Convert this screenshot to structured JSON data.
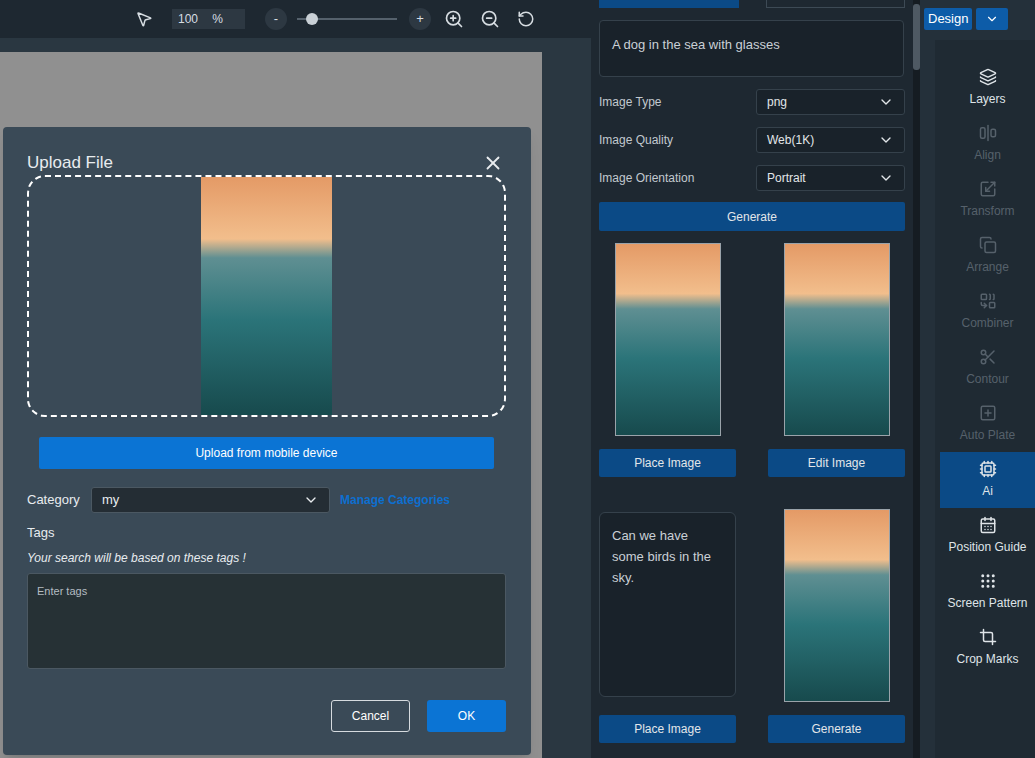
{
  "toolbar": {
    "zoom": "100",
    "unit": "%",
    "zoom_out_button": "-",
    "zoom_in_button": "+",
    "zoom_slider": {
      "level": 0.15
    }
  },
  "upload_dialog": {
    "title": "Upload File",
    "upload_button": "Upload from mobile device",
    "category": {
      "label": "Category",
      "value": "my",
      "link": "Manage Categories"
    },
    "tags": {
      "label": "Tags",
      "hint": "Your search will be based on these tags !",
      "placeholder": "Enter tags"
    },
    "buttons": [
      {
        "label": "Cancel",
        "primary": false
      },
      {
        "label": "OK",
        "primary": true
      }
    ]
  },
  "ai_panel": {
    "prompt": "A dog in the sea with glasses",
    "settings": [
      {
        "label": "Image Type",
        "value": "png"
      },
      {
        "label": "Image Quality",
        "value": "Web(1K)"
      },
      {
        "label": "Image Orientation",
        "value": "Portrait"
      }
    ],
    "generate_button": "Generate",
    "results": [
      {
        "kind": "image",
        "button": "Place Image"
      },
      {
        "kind": "image",
        "button": "Edit Image"
      },
      {
        "kind": "prompt",
        "text": "Can we have some birds in the sky.",
        "button": "Place Image"
      },
      {
        "kind": "image",
        "button": "Generate"
      }
    ]
  },
  "sidebar": {
    "design_button": "Design",
    "items": [
      {
        "label": "Layers",
        "selected": false,
        "disabled": false
      },
      {
        "label": "Align",
        "selected": false,
        "disabled": true
      },
      {
        "label": "Transform",
        "selected": false,
        "disabled": true
      },
      {
        "label": "Arrange",
        "selected": false,
        "disabled": true
      },
      {
        "label": "Combiner",
        "selected": false,
        "disabled": true
      },
      {
        "label": "Contour",
        "selected": false,
        "disabled": true
      },
      {
        "label": "Auto Plate",
        "selected": false,
        "disabled": true
      },
      {
        "label": "Ai",
        "selected": true,
        "disabled": false
      },
      {
        "label": "Position Guide",
        "selected": false,
        "disabled": false
      },
      {
        "label": "Screen Pattern",
        "selected": false,
        "disabled": false
      },
      {
        "label": "Crop Marks",
        "selected": false,
        "disabled": false
      }
    ]
  }
}
